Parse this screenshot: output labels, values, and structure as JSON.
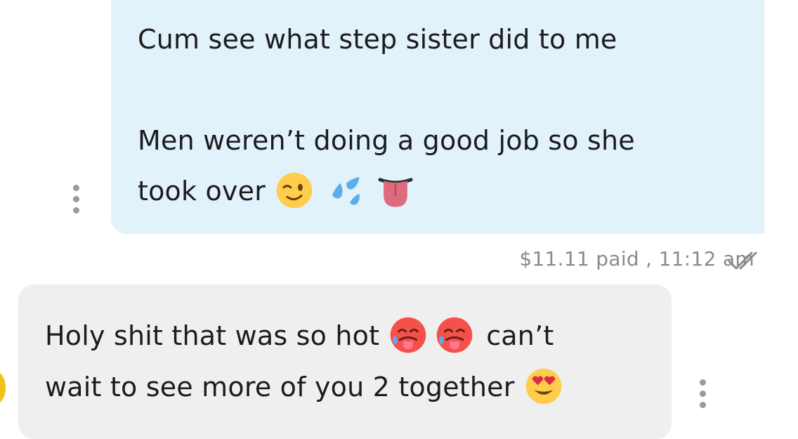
{
  "outgoing_message": {
    "line1": "Cum see what step sister did to me",
    "line2": "Men weren’t doing a good job so she",
    "line3_text": "took over",
    "emoji_icons": [
      "winking-face-icon",
      "sweat-droplets-icon",
      "tongue-icon"
    ],
    "meta": "$11.11 paid , 11:12 am"
  },
  "incoming_message": {
    "line1_text": "Holy shit that was so hot",
    "line1_end": "can’t",
    "line2_text": "wait to see more of you 2 together",
    "emoji_icons": [
      "hot-face-icon",
      "hot-face-icon",
      "heart-eyes-face-icon"
    ]
  },
  "colors": {
    "outgoing_bubble": "#e2f2fa",
    "incoming_bubble": "#efeff0",
    "meta_text": "#8a8a8e",
    "avatar": "#f2c21b"
  }
}
